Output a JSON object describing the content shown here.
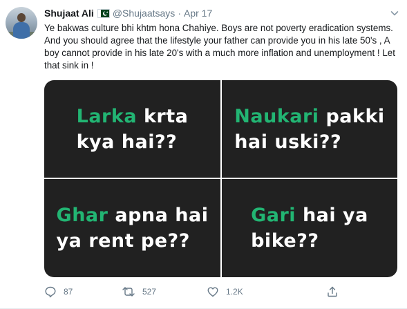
{
  "author": {
    "name": "Shujaat Ali",
    "handle": "@Shujaatsays",
    "separator": "·",
    "date": "Apr 17"
  },
  "tweet_text": "Ye bakwas culture bhi khtm hona Chahiye. Boys are not poverty eradication systems. And you should agree that the lifestyle your father can provide you in his late 50's , A boy cannot provide in his late 20's with a much more inflation and unemployment ! Let that sink in !",
  "media": {
    "tiles": [
      {
        "highlight": "Larka",
        "line1_rest": " krta",
        "line2": "kya hai??"
      },
      {
        "highlight": "Naukari",
        "line1_rest": " pakki",
        "line2": "hai uski??"
      },
      {
        "highlight": "Ghar",
        "line1_rest": " apna hai",
        "line2": "ya rent pe??"
      },
      {
        "highlight": "Gari",
        "line1_rest": " hai ya",
        "line2": "bike??"
      }
    ],
    "highlight_color": "#22b573",
    "tile_background": "#212121"
  },
  "actions": {
    "reply_count": "87",
    "retweet_count": "527",
    "like_count": "1.2K"
  },
  "icons": [
    "avatar",
    "pakistan-flag-icon",
    "chevron-down-icon",
    "reply-icon",
    "retweet-icon",
    "like-icon",
    "share-icon"
  ]
}
